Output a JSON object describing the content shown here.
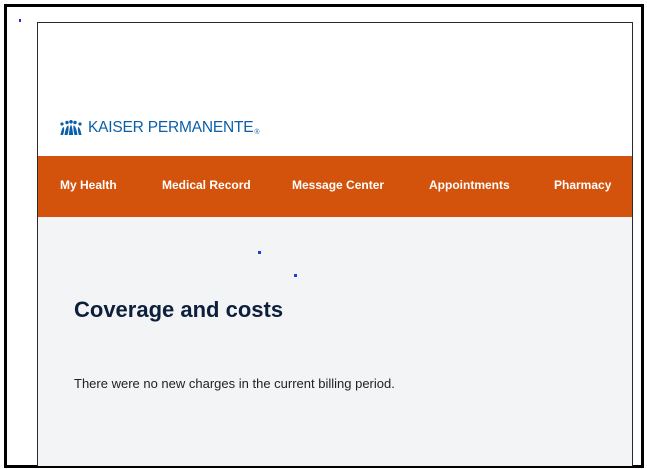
{
  "brand": {
    "name": "KAISER PERMANENTE",
    "registered_mark": "®",
    "color": "#0b5fa8"
  },
  "nav": {
    "background": "#d3520c",
    "items": [
      {
        "label": "My Health",
        "icon": ""
      },
      {
        "label": "Medical Record",
        "icon": ""
      },
      {
        "label": "Message Center",
        "icon": ""
      },
      {
        "label": "Appointments",
        "icon": ""
      },
      {
        "label": "Pharmacy",
        "icon": ""
      }
    ]
  },
  "main": {
    "title": "Coverage and costs",
    "message": "There were no new charges in the current billing period."
  }
}
